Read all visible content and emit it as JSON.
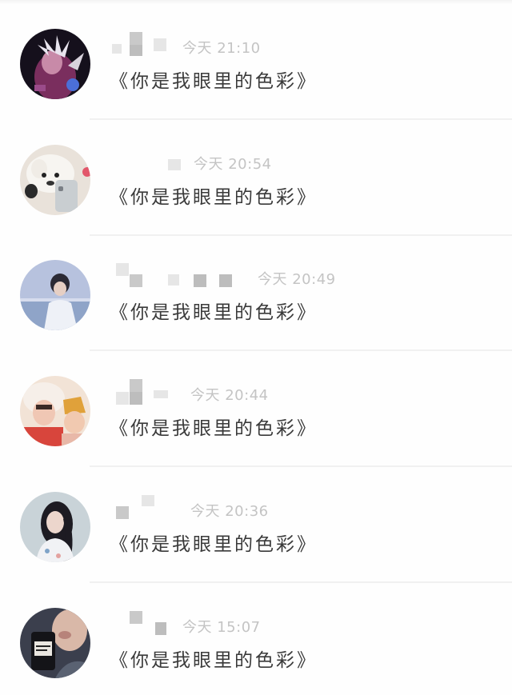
{
  "messages": [
    {
      "time": "今天 21:10",
      "text": "《你是我眼里的色彩》"
    },
    {
      "time": "今天 20:54",
      "text": "《你是我眼里的色彩》"
    },
    {
      "time": "今天 20:49",
      "text": "《你是我眼里的色彩》"
    },
    {
      "time": "今天 20:44",
      "text": "《你是我眼里的色彩》"
    },
    {
      "time": "今天 20:36",
      "text": "《你是我眼里的色彩》"
    },
    {
      "time": "今天 15:07",
      "text": "《你是我眼里的色彩》"
    }
  ],
  "icons": {
    "avatar_1": "avatar-fantasy-character",
    "avatar_2": "avatar-white-puppy-with-phone",
    "avatar_3": "avatar-boy-by-the-sea",
    "avatar_4": "avatar-two-kids-in-hats",
    "avatar_5": "avatar-girl-long-hair",
    "avatar_6": "avatar-man-holding-bottle"
  }
}
